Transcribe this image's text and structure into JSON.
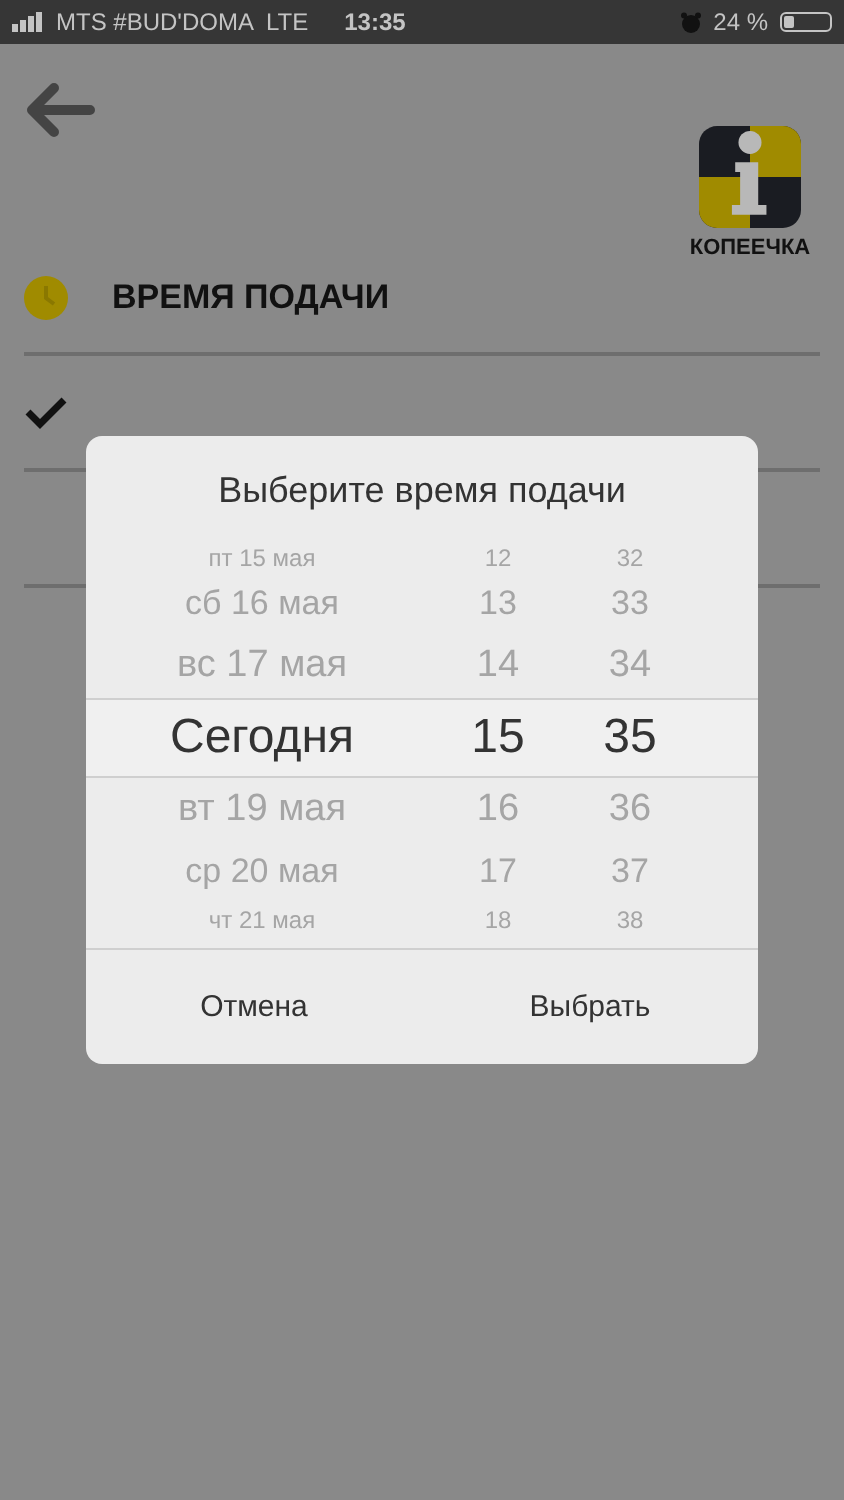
{
  "status_bar": {
    "carrier": "MTS #BUD'DOMA",
    "network": "LTE",
    "time": "13:35",
    "battery": "24 %"
  },
  "logo": {
    "text": "КОПЕЕЧКА"
  },
  "section": {
    "title": "ВРЕМЯ ПОДАЧИ"
  },
  "options": [
    {
      "checked": true
    }
  ],
  "dialog": {
    "title": "Выберите время подачи",
    "rows": [
      {
        "day": "пт 15 мая",
        "hour": "12",
        "minute": "32",
        "selected": false
      },
      {
        "day": "сб 16 мая",
        "hour": "13",
        "minute": "33",
        "selected": false
      },
      {
        "day": "вс 17 мая",
        "hour": "14",
        "minute": "34",
        "selected": false
      },
      {
        "day": "Сегодня",
        "hour": "15",
        "minute": "35",
        "selected": true
      },
      {
        "day": "вт 19 мая",
        "hour": "16",
        "minute": "36",
        "selected": false
      },
      {
        "day": "ср 20 мая",
        "hour": "17",
        "minute": "37",
        "selected": false
      },
      {
        "day": "чт 21 мая",
        "hour": "18",
        "minute": "38",
        "selected": false
      }
    ],
    "buttons": [
      "Отмена",
      "Выбрать"
    ]
  }
}
